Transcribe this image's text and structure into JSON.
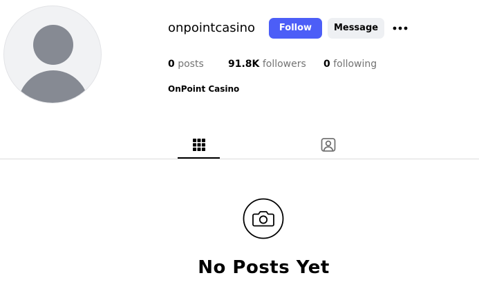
{
  "profile": {
    "username": "onpointcasino",
    "full_name": "OnPoint Casino",
    "avatar_icon": "default-user-avatar"
  },
  "actions": {
    "follow_label": "Follow",
    "message_label": "Message",
    "more_icon": "more-horizontal-icon"
  },
  "stats": {
    "posts_count": "0",
    "posts_label": "posts",
    "followers_count": "91.8K",
    "followers_label": "followers",
    "following_count": "0",
    "following_label": "following"
  },
  "tabs": [
    {
      "icon": "grid-icon",
      "active": true
    },
    {
      "icon": "tagged-user-icon",
      "active": false
    }
  ],
  "empty_state": {
    "icon": "camera-icon",
    "title": "No Posts Yet"
  },
  "colors": {
    "follow_button": "#4c5ef7",
    "message_button": "#eef0f3",
    "avatar_silhouette": "#868a93",
    "muted_text": "#737373"
  }
}
